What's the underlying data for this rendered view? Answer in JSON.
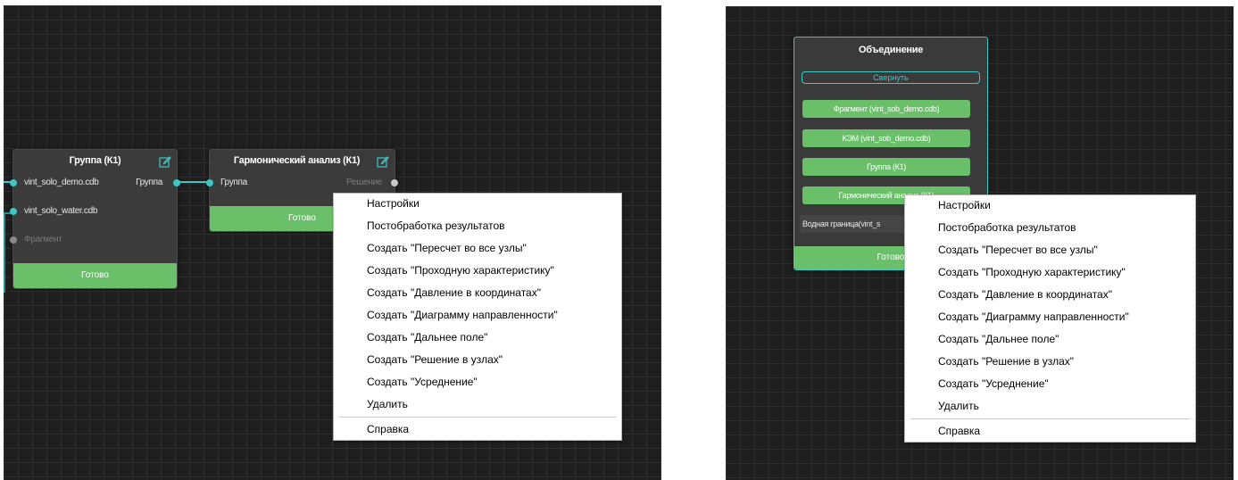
{
  "left_panel": {
    "group_node": {
      "title": "Группа (К1)",
      "inputs": [
        "vint_solo_demo.cdb",
        "vint_solo_water.cdb",
        "Фрагмент"
      ],
      "output": "Группа",
      "status": "Готово"
    },
    "harmonic_node": {
      "title": "Гармонический анализ (К1)",
      "input": "Группа",
      "output": "Решение",
      "status": "Готово"
    },
    "context_menu": {
      "items": [
        "Настройки",
        "Постобработка результатов",
        "Создать \"Пересчет во все узлы\"",
        "Создать \"Проходную характеристику\"",
        "Создать \"Давление в координатах\"",
        "Создать \"Диаграмму направленности\"",
        "Создать \"Дальнее поле\"",
        "Создать \"Решение в узлах\"",
        "Создать \"Усреднение\"",
        "Удалить"
      ],
      "help": "Справка"
    }
  },
  "right_panel": {
    "union_node": {
      "title": "Объединение",
      "collapse_label": "Свернуть",
      "items": [
        "Фрагмент (vint_sob_demo.cdb)",
        "КЭМ (vint_sob_demo.cdb)",
        "Группа (К1)",
        "Гармонический анализ (К1)",
        "Водная граница(vint_s"
      ],
      "status": "Готово"
    },
    "context_menu": {
      "items": [
        "Настройки",
        "Постобработка результатов",
        "Создать \"Пересчет во все узлы\"",
        "Создать \"Проходную характеристику\"",
        "Создать \"Давление в координатах\"",
        "Создать \"Диаграмму направленности\"",
        "Создать \"Дальнее поле\"",
        "Создать \"Решение в узлах\"",
        "Создать \"Усреднение\"",
        "Удалить"
      ],
      "help": "Справка"
    }
  },
  "colors": {
    "canvas": "#1e1e1e",
    "grid": "#2e2e2e",
    "node": "#3b3b3b",
    "accent_teal": "#3cc7c7",
    "status_green": "#6abf69"
  },
  "icons": [
    "edit-icon",
    "port-dot-icon"
  ]
}
